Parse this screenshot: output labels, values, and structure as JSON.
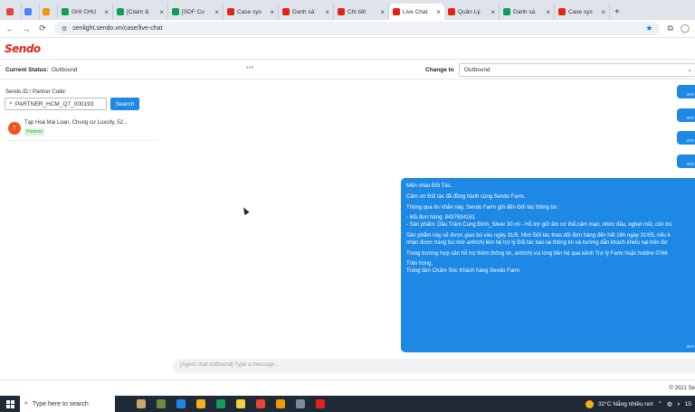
{
  "browser": {
    "tabs": [
      {
        "label": "",
        "color": "#ea4335",
        "kind": "small"
      },
      {
        "label": "",
        "color": "#4285f4",
        "kind": "small"
      },
      {
        "label": "",
        "color": "#f29900",
        "kind": "small"
      },
      {
        "label": "GHI CHÚ",
        "color": "#0f9d58"
      },
      {
        "label": "[Claim &",
        "color": "#0f9d58"
      },
      {
        "label": "[SDF Cu",
        "color": "#0f9d58"
      },
      {
        "label": "Case sys",
        "color": "#e2231a"
      },
      {
        "label": "Danh sá",
        "color": "#e2231a"
      },
      {
        "label": "Chi tiết",
        "color": "#e2231a"
      },
      {
        "label": "Live Chat",
        "color": "#e2231a",
        "active": true
      },
      {
        "label": "Quản Lý",
        "color": "#e2231a"
      },
      {
        "label": "Danh sá",
        "color": "#0f9d58"
      },
      {
        "label": "Case sys",
        "color": "#e2231a"
      }
    ],
    "url": "senlight.sendo.vn/case/live-chat"
  },
  "app": {
    "logo": "Sendo",
    "status_label": "Current Status:",
    "status_value": "Outbound",
    "change_label": "Change to",
    "change_value": "Outbound",
    "dots": "•••"
  },
  "search": {
    "label": "Sendo ID / Partner Code:",
    "value": "PARTNER_HCM_Q7_000193",
    "button": "Search"
  },
  "contact": {
    "initial": "T",
    "name": "Tạp Hoá Mai Loan, Chung cư Luxcity, 52...",
    "tag": "Partner"
  },
  "chat": {
    "small_bubbles": [
      {
        "time": "30/0"
      },
      {
        "time": "30/0"
      },
      {
        "time": "30/0"
      },
      {
        "time": "30/0"
      }
    ],
    "message_lines": [
      "Mến chào Đối Tác,",
      "",
      "Cảm ơn Đối tác đã đồng hành cùng Sendo Farm.",
      "",
      "Thông qua tin nhắn này, Sendo Farm gửi đến Đối tác thông tin:",
      "",
      "- Mã đơn hàng: 8437634161",
      "- Sản phẩm: Dầu Tràm Cung Đình_Silver 30 ml - Hỗ trợ giữ ấm cơ thể,cảm mạo, nhức đầu, nghẹt mũi, côn trù",
      "",
      "Sản phẩm này sẽ được giao bù vào ngày 31/5. Nhờ Đối tác theo dõi đơn hàng đến hết 16h ngày 31/05, nếu k",
      "nhận được hàng bù nhờ anh/chị liên hệ trợ lý Đối tác báo lại thông tin và hướng dẫn khách khiếu nại trên đơ",
      "",
      "Trong trường hợp cần hỗ trợ thêm thông tin, anh/chị vui lòng liên hệ qua kênh Trợ lý Farm hoặc hotline 0766",
      "",
      "Trân trọng,",
      "Trung tâm Chăm Sóc Khách hàng Sendo Farm"
    ],
    "message_time": "30/0",
    "input_placeholder": "[Agent chat outbound] Type a message..."
  },
  "footer": {
    "copyright": "© 2021 Se"
  },
  "taskbar": {
    "search_placeholder": "Type here to search",
    "icons": [
      {
        "name": "task-view-icon",
        "color": "#c9a66b"
      },
      {
        "name": "widgets-icon",
        "color": "#6d8b3a"
      },
      {
        "name": "edge-icon",
        "color": "#1e88e5"
      },
      {
        "name": "file-explorer-icon",
        "color": "#f2b01e"
      },
      {
        "name": "sheets-icon",
        "color": "#0f9d58"
      },
      {
        "name": "sticky-notes-icon",
        "color": "#f4d03f"
      },
      {
        "name": "chrome-icon",
        "color": "#ea4335"
      },
      {
        "name": "app-icon",
        "color": "#f29900"
      },
      {
        "name": "app2-icon",
        "color": "#7a8ca0"
      },
      {
        "name": "sendo-icon",
        "color": "#e2231a"
      }
    ],
    "weather": "32°C  Nắng nhiều nơi",
    "time": "15"
  }
}
